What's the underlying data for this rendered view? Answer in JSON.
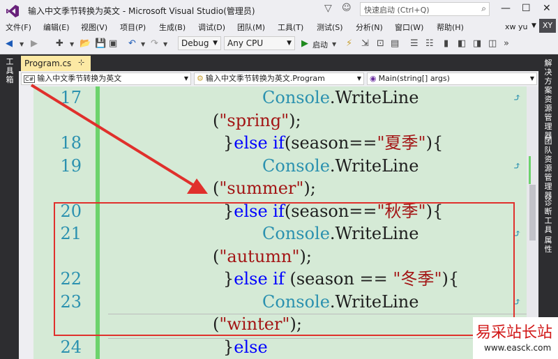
{
  "window": {
    "title": "输入中文季节转换为英文 - Microsoft Visual Studio(管理员)",
    "quick_launch_placeholder": "快速启动 (Ctrl+Q)",
    "minimize_icon": "minimize-icon",
    "maximize_icon": "maximize-icon",
    "close_icon": "close-icon"
  },
  "menu": [
    "文件(F)",
    "编辑(E)",
    "视图(V)",
    "项目(P)",
    "生成(B)",
    "调试(D)",
    "团队(M)",
    "工具(T)",
    "测试(S)",
    "分析(N)",
    "窗口(W)",
    "帮助(H)"
  ],
  "user": {
    "name": "xw yu",
    "initials": "XY"
  },
  "toolbar": {
    "configuration": "Debug",
    "platform": "Any CPU",
    "start_label": "启动"
  },
  "tool_windows": {
    "left": "工具箱",
    "right": [
      "解决方案资源管理器",
      "团队资源管理器",
      "诊断工具",
      "属性"
    ]
  },
  "document_tab": {
    "label": "Program.cs"
  },
  "navbar": {
    "project": "输入中文季节转换为英文",
    "class": "输入中文季节转换为英文.Program",
    "member": "Main(string[] args)"
  },
  "code_lines": [
    {
      "num": "17",
      "indent": 376,
      "parts": [
        [
          "type",
          "Console"
        ],
        [
          "plain",
          ".WriteLine"
        ]
      ],
      "bulb": true
    },
    {
      "num": "",
      "indent": 305,
      "parts": [
        [
          "plain",
          "("
        ],
        [
          "str",
          "\"spring\""
        ],
        [
          "plain",
          ");"
        ]
      ]
    },
    {
      "num": "18",
      "indent": 320,
      "parts": [
        [
          "plain",
          "}"
        ],
        [
          "kw",
          "else if"
        ],
        [
          "plain",
          "(season=="
        ],
        [
          "str",
          "\"夏季\""
        ],
        [
          "plain",
          "){"
        ]
      ]
    },
    {
      "num": "19",
      "indent": 376,
      "parts": [
        [
          "type",
          "Console"
        ],
        [
          "plain",
          ".WriteLine"
        ]
      ],
      "bulb": true
    },
    {
      "num": "",
      "indent": 305,
      "parts": [
        [
          "plain",
          "("
        ],
        [
          "str",
          "\"summer\""
        ],
        [
          "plain",
          ");"
        ]
      ]
    },
    {
      "num": "20",
      "indent": 320,
      "parts": [
        [
          "plain",
          "}"
        ],
        [
          "kw",
          "else if"
        ],
        [
          "plain",
          "(season=="
        ],
        [
          "str",
          "\"秋季\""
        ],
        [
          "plain",
          "){"
        ]
      ]
    },
    {
      "num": "21",
      "indent": 376,
      "parts": [
        [
          "type",
          "Console"
        ],
        [
          "plain",
          ".WriteLine"
        ]
      ],
      "bulb": true
    },
    {
      "num": "",
      "indent": 305,
      "parts": [
        [
          "plain",
          "("
        ],
        [
          "str",
          "\"autumn\""
        ],
        [
          "plain",
          ");"
        ]
      ]
    },
    {
      "num": "22",
      "indent": 320,
      "parts": [
        [
          "plain",
          "}"
        ],
        [
          "kw",
          "else if"
        ],
        [
          "plain",
          " (season == "
        ],
        [
          "str",
          "\"冬季\""
        ],
        [
          "plain",
          "){"
        ]
      ]
    },
    {
      "num": "23",
      "indent": 376,
      "parts": [
        [
          "type",
          "Console"
        ],
        [
          "plain",
          ".WriteLine"
        ]
      ],
      "bulb": true
    },
    {
      "num": "",
      "indent": 305,
      "parts": [
        [
          "plain",
          "("
        ],
        [
          "str",
          "\"winter\""
        ],
        [
          "plain",
          ");"
        ]
      ]
    },
    {
      "num": "24",
      "indent": 320,
      "parts": [
        [
          "plain",
          "}"
        ],
        [
          "kw",
          "else"
        ]
      ]
    }
  ],
  "colors": {
    "editor_background": "#d5ead6",
    "keyword": "#0000ff",
    "type": "#2b91af",
    "string": "#a31515",
    "annotation": "#e0302c",
    "change_bar": "#6cd36c"
  },
  "watermark": {
    "title": "易采站长站",
    "url": "www.easck.com"
  }
}
